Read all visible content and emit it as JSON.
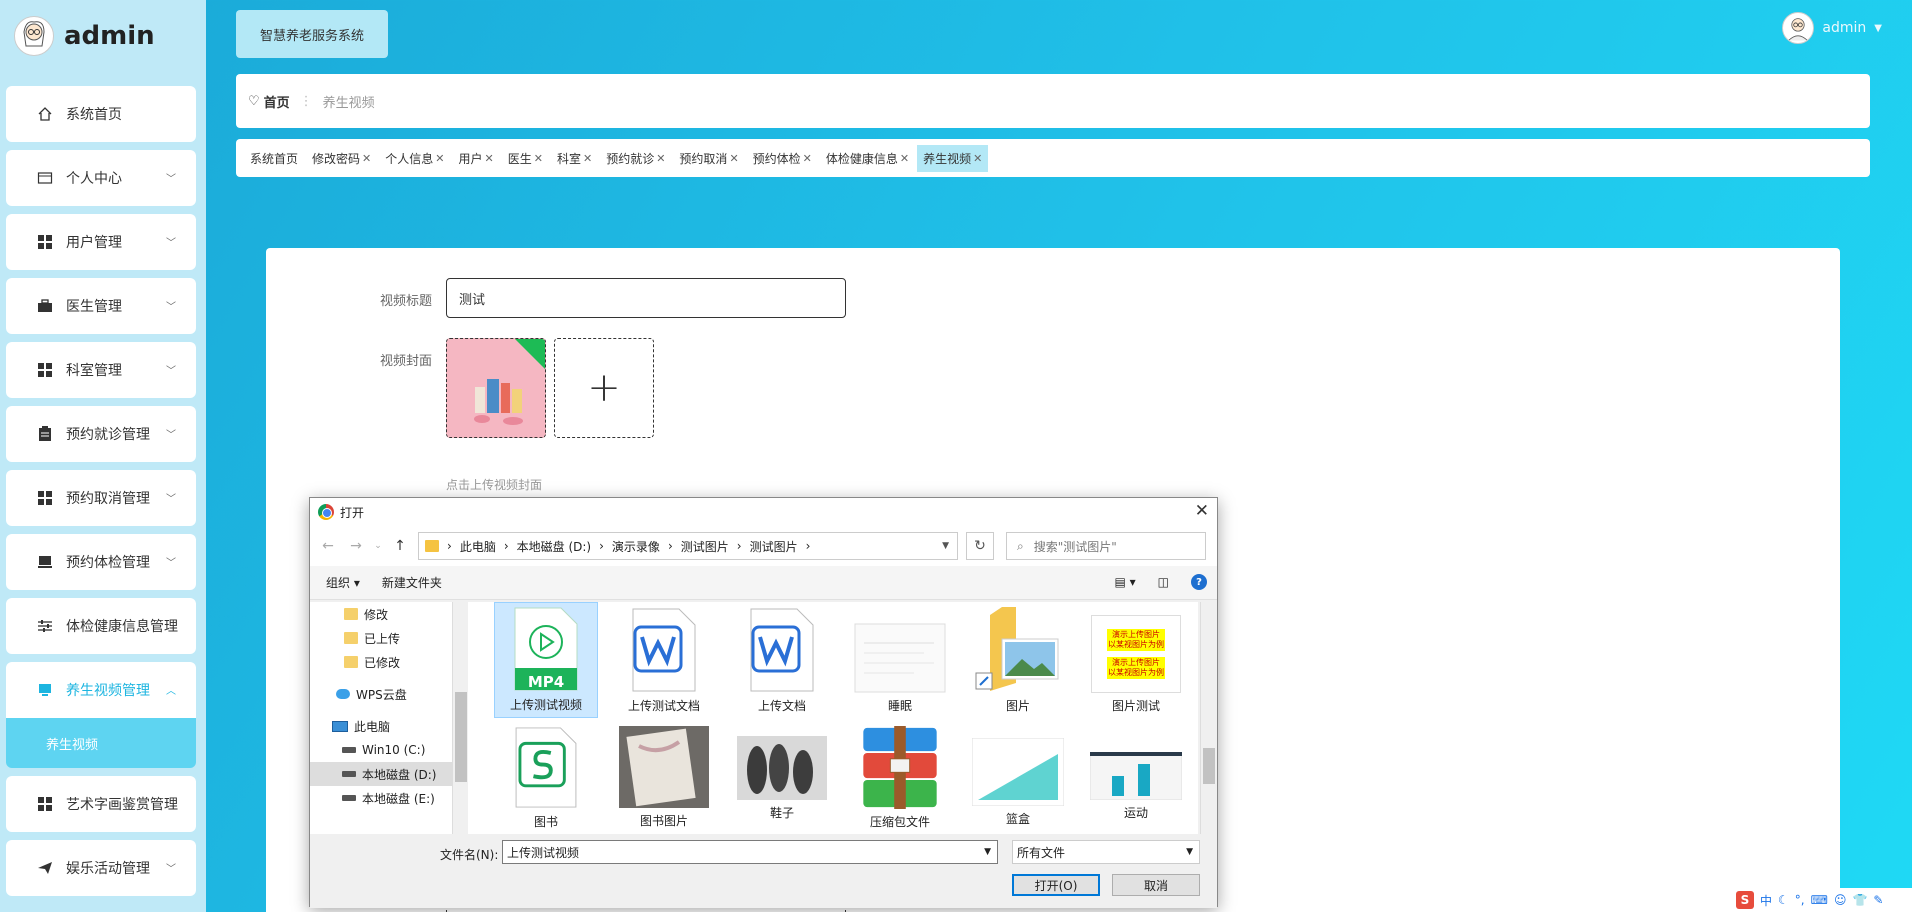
{
  "brand": {
    "name": "admin"
  },
  "sidebar": {
    "items": [
      {
        "label": "系统首页",
        "icon": "home-icon"
      },
      {
        "label": "个人中心",
        "icon": "card-icon"
      },
      {
        "label": "用户管理",
        "icon": "grid-icon"
      },
      {
        "label": "医生管理",
        "icon": "briefcase-icon"
      },
      {
        "label": "科室管理",
        "icon": "grid-icon"
      },
      {
        "label": "预约就诊管理",
        "icon": "clipboard-icon"
      },
      {
        "label": "预约取消管理",
        "icon": "grid-icon"
      },
      {
        "label": "预约体检管理",
        "icon": "monitor-icon"
      },
      {
        "label": "体检健康信息管理",
        "icon": "sliders-icon"
      },
      {
        "label": "养生视频管理",
        "icon": "monitor-icon"
      },
      {
        "label": "养生视频",
        "icon": ""
      },
      {
        "label": "艺术字画鉴赏管理",
        "icon": "grid-icon"
      },
      {
        "label": "娱乐活动管理",
        "icon": "send-icon"
      }
    ]
  },
  "header": {
    "system_button": "智慧养老服务系统",
    "user": "admin"
  },
  "breadcrumb": {
    "home": "首页",
    "current": "养生视频"
  },
  "tags": [
    "系统首页",
    "修改密码",
    "个人信息",
    "用户",
    "医生",
    "科室",
    "预约就诊",
    "预约取消",
    "预约体检",
    "体检健康信息",
    "养生视频"
  ],
  "form": {
    "title_label": "视频标题",
    "title_value": "测试",
    "cover_label": "视频封面",
    "upload_plus": "+",
    "upload_hint": "点击上传视频封面"
  },
  "dialog": {
    "title": "打开",
    "path": [
      "此电脑",
      "本地磁盘 (D:)",
      "演示录像",
      "测试图片",
      "测试图片"
    ],
    "search_placeholder": "搜索\"测试图片\"",
    "organize": "组织 ▾",
    "new_folder": "新建文件夹",
    "tree": [
      {
        "label": "修改",
        "type": "folder"
      },
      {
        "label": "已上传",
        "type": "folder"
      },
      {
        "label": "已修改",
        "type": "folder"
      },
      {
        "label": "WPS云盘",
        "type": "cloud"
      },
      {
        "label": "此电脑",
        "type": "pc"
      },
      {
        "label": "Win10 (C:)",
        "type": "drive"
      },
      {
        "label": "本地磁盘 (D:)",
        "type": "drive"
      },
      {
        "label": "本地磁盘 (E:)",
        "type": "drive"
      }
    ],
    "files": [
      {
        "name": "上传测试视频",
        "kind": "mp4"
      },
      {
        "name": "上传测试文档",
        "kind": "word"
      },
      {
        "name": "上传文档",
        "kind": "word"
      },
      {
        "name": "睡眠",
        "kind": "image-doc"
      },
      {
        "name": "图片",
        "kind": "folder-shortcut"
      },
      {
        "name": "图片测试",
        "kind": "image-yellow"
      },
      {
        "name": "图书",
        "kind": "wps-sheet"
      },
      {
        "name": "图书图片",
        "kind": "photo"
      },
      {
        "name": "鞋子",
        "kind": "photo-shoes"
      },
      {
        "name": "压缩包文件",
        "kind": "archive"
      },
      {
        "name": "篮盒",
        "kind": "image-chart"
      },
      {
        "name": "运动",
        "kind": "image-bars"
      }
    ],
    "mp4_badge": "MP4",
    "image_test_text": "演示上传图片\n以某视图片为例\n演示上传图片\n以某视图片为例",
    "filename_label": "文件名(N):",
    "filename_value": "上传测试视频",
    "filetype_value": "所有文件",
    "open_button": "打开(O)",
    "cancel_button": "取消"
  },
  "ime": {
    "lang": "中"
  },
  "colors": {
    "accent": "#1db5e0",
    "sidebar_bg": "#bfe9f7",
    "active_sub": "#5ed4f1"
  }
}
